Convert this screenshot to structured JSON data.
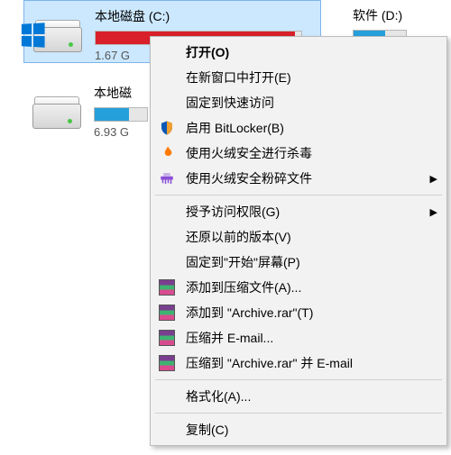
{
  "drives": {
    "c": {
      "label": "本地磁盘 (C:)",
      "free": "1.67 G",
      "bar_color": "red"
    },
    "d": {
      "label": "软件 (D:)",
      "free": "",
      "bar_color": "blue"
    },
    "local2": {
      "label": "本地磁",
      "free": "6.93 G",
      "bar_color": "blue"
    }
  },
  "menu": {
    "open": "打开(O)",
    "open_new_window": "在新窗口中打开(E)",
    "pin_quick_access": "固定到快速访问",
    "bitlocker": "启用 BitLocker(B)",
    "huorong_scan": "使用火绒安全进行杀毒",
    "huorong_shred": "使用火绒安全粉碎文件",
    "grant_access": "授予访问权限(G)",
    "restore_versions": "还原以前的版本(V)",
    "pin_start": "固定到\"开始\"屏幕(P)",
    "rar_add": "添加到压缩文件(A)...",
    "rar_add_archive": "添加到 \"Archive.rar\"(T)",
    "rar_email": "压缩并 E-mail...",
    "rar_archive_email": "压缩到 \"Archive.rar\" 并 E-mail",
    "format": "格式化(A)...",
    "copy": "复制(C)"
  },
  "submenu_arrow": "▶"
}
